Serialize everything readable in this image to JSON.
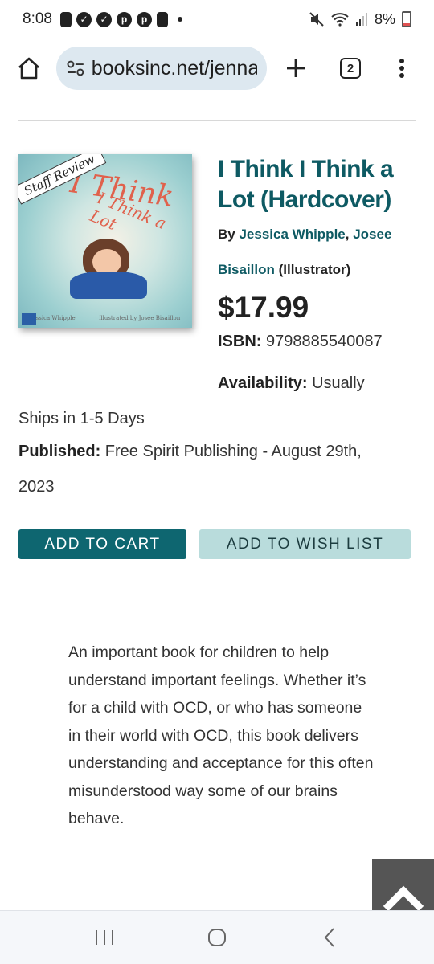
{
  "status_bar": {
    "time": "8:08",
    "battery": "8%"
  },
  "browser": {
    "url": "booksinc.net/jenna",
    "tab_count": "2"
  },
  "book": {
    "cover": {
      "banner": "Staff Review",
      "title_text": "I Think",
      "subtitle_text": "I Think a Lot",
      "author_credit": "Jessica Whipple",
      "illustrator_credit": "illustrated by Josée Bisaillon"
    },
    "title": "I Think I Think a Lot (Hardcover)",
    "by_label": "By",
    "author": "Jessica Whipple",
    "separator": ",",
    "illustrator": "Josee Bisaillon",
    "illustrator_role": "(Illustrator)",
    "price": "$17.99",
    "isbn_label": "ISBN:",
    "isbn": "9798885540087",
    "availability_label": "Availability:",
    "availability_part1": "Usually",
    "availability_part2": "Ships in 1-5 Days",
    "published_label": "Published:",
    "published_value": "Free Spirit Publishing - August 29th,",
    "published_year": "2023"
  },
  "actions": {
    "add_to_cart": "ADD TO CART",
    "add_to_wish_list": "ADD TO WISH LIST"
  },
  "description": "An important book for children to help understand important feelings. Whether it’s for a child with OCD, or who has someone in their world with OCD, this book delivers understanding and acceptance for this often misunderstood way some of our brains behave."
}
